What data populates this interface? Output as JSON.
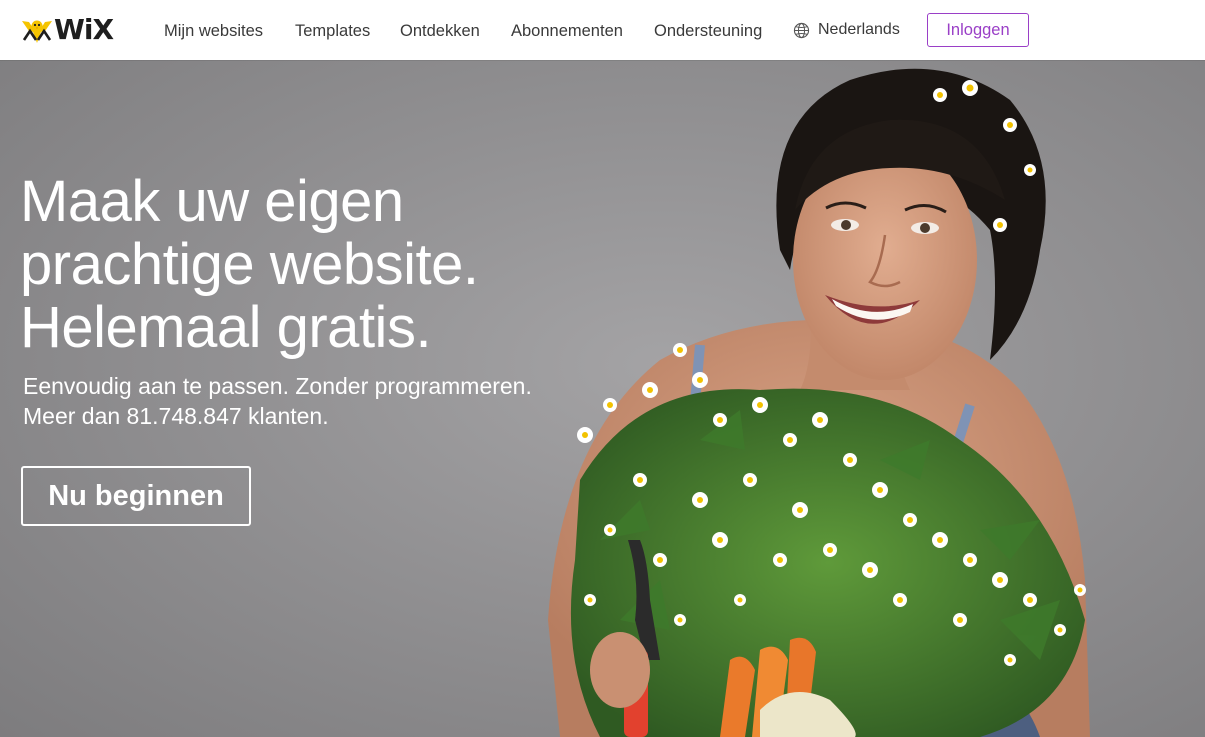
{
  "brand": {
    "name": "WiX",
    "accent": "#9a3fc7",
    "logo_yellow": "#f5c400"
  },
  "nav": {
    "items": [
      {
        "label": "Mijn websites"
      },
      {
        "label": "Templates"
      },
      {
        "label": "Ontdekken"
      },
      {
        "label": "Abonnementen"
      },
      {
        "label": "Ondersteuning"
      }
    ],
    "language": {
      "icon": "globe-icon",
      "label": "Nederlands"
    },
    "login_label": "Inloggen"
  },
  "hero": {
    "headline_lines": [
      "Maak uw eigen",
      "prachtige website.",
      "Helemaal gratis."
    ],
    "subline_lines": [
      "Eenvoudig aan te passen. Zonder programmeren.",
      "Meer dan 81.748.847 klanten."
    ],
    "cta_label": "Nu beginnen",
    "image": "smiling woman holding a bouquet of chamomile flowers, carrots and pruning shears"
  }
}
